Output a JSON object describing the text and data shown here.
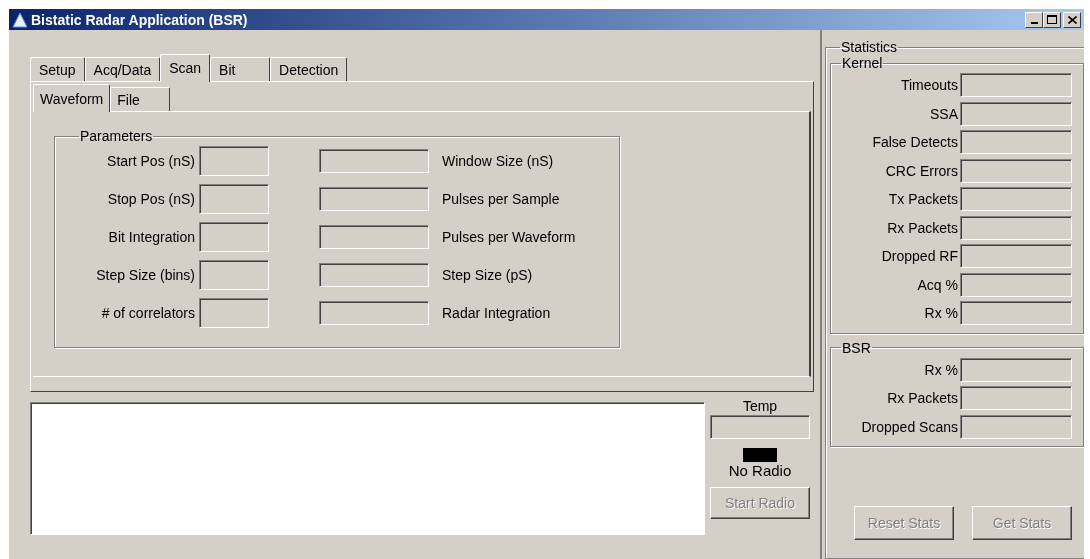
{
  "window": {
    "title": "Bistatic Radar Application (BSR)"
  },
  "tabs": [
    {
      "label": "Setup",
      "selected": false
    },
    {
      "label": "Acq/Data",
      "selected": false
    },
    {
      "label": "Scan",
      "selected": true
    },
    {
      "label": "Bit",
      "selected": false
    },
    {
      "label": "Detection",
      "selected": false
    }
  ],
  "subtabs": [
    {
      "label": "Waveform",
      "selected": true
    },
    {
      "label": "File",
      "selected": false
    }
  ],
  "parameters": {
    "title": "Parameters",
    "rows": [
      {
        "left_label": "Start Pos (nS)",
        "right_label": "Window Size (nS)"
      },
      {
        "left_label": "Stop Pos (nS)",
        "right_label": "Pulses per Sample"
      },
      {
        "left_label": "Bit Integration",
        "right_label": "Pulses per Waveform"
      },
      {
        "left_label": "Step Size (bins)",
        "right_label": "Step Size (pS)"
      },
      {
        "left_label": "# of correlators",
        "right_label": "Radar Integration"
      }
    ]
  },
  "temp": {
    "label": "Temp"
  },
  "radio": {
    "status": "No Radio",
    "button": {
      "label": "Start Radio",
      "disabled": true
    }
  },
  "statistics": {
    "title": "Statistics",
    "groups": [
      {
        "title": "Kernel",
        "fields": [
          "Timeouts",
          "SSA",
          "False Detects",
          "CRC Errors",
          "Tx Packets",
          "Rx Packets",
          "Dropped RF",
          "Acq %",
          "Rx %"
        ]
      },
      {
        "title": "BSR",
        "fields": [
          "Rx %",
          "Rx Packets",
          "Dropped Scans"
        ]
      }
    ],
    "buttons": [
      {
        "label": "Reset Stats",
        "disabled": true
      },
      {
        "label": "Get Stats",
        "disabled": true
      }
    ]
  }
}
